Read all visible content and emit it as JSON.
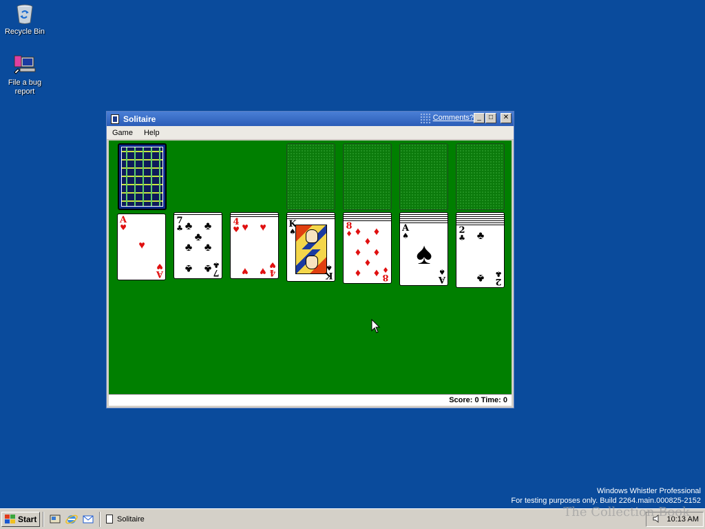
{
  "desktop": {
    "icons": [
      {
        "label": "Recycle Bin",
        "icon": "recycle-bin-icon"
      },
      {
        "label": "File a bug\nreport",
        "icon": "bug-report-icon"
      }
    ],
    "background_color": "#0a4b9c"
  },
  "window": {
    "title": "Solitaire",
    "comments_link": "Comments?",
    "controls": {
      "minimize": "_",
      "maximize": "□",
      "close": "✕"
    },
    "menu": [
      "Game",
      "Help"
    ],
    "status": "Score: 0 Time: 0",
    "felt_color": "#007f00"
  },
  "game": {
    "deck": {
      "state": "face-down"
    },
    "foundations": [
      "",
      "",
      "",
      ""
    ],
    "tableau": [
      {
        "rank": "A",
        "suit": "♥",
        "color": "red",
        "hidden_above": 0
      },
      {
        "rank": "7",
        "suit": "♣",
        "color": "black",
        "hidden_above": 1
      },
      {
        "rank": "4",
        "suit": "♥",
        "color": "red",
        "hidden_above": 2
      },
      {
        "rank": "K",
        "suit": "♠",
        "color": "black",
        "hidden_above": 3
      },
      {
        "rank": "8",
        "suit": "♦",
        "color": "red",
        "hidden_above": 4
      },
      {
        "rank": "A",
        "suit": "♠",
        "color": "black",
        "hidden_above": 5
      },
      {
        "rank": "2",
        "suit": "♣",
        "color": "black",
        "hidden_above": 6
      }
    ]
  },
  "watermark": {
    "line1": "Windows Whistler Professional",
    "line2": "For testing purposes only. Build 2264.main.000825-2152"
  },
  "overlay_text": "The Collection Book",
  "taskbar": {
    "start_label": "Start",
    "quick_launch": [
      "show-desktop-icon",
      "internet-explorer-icon",
      "outlook-express-icon"
    ],
    "task_label": "Solitaire",
    "clock": "10:13 AM"
  }
}
